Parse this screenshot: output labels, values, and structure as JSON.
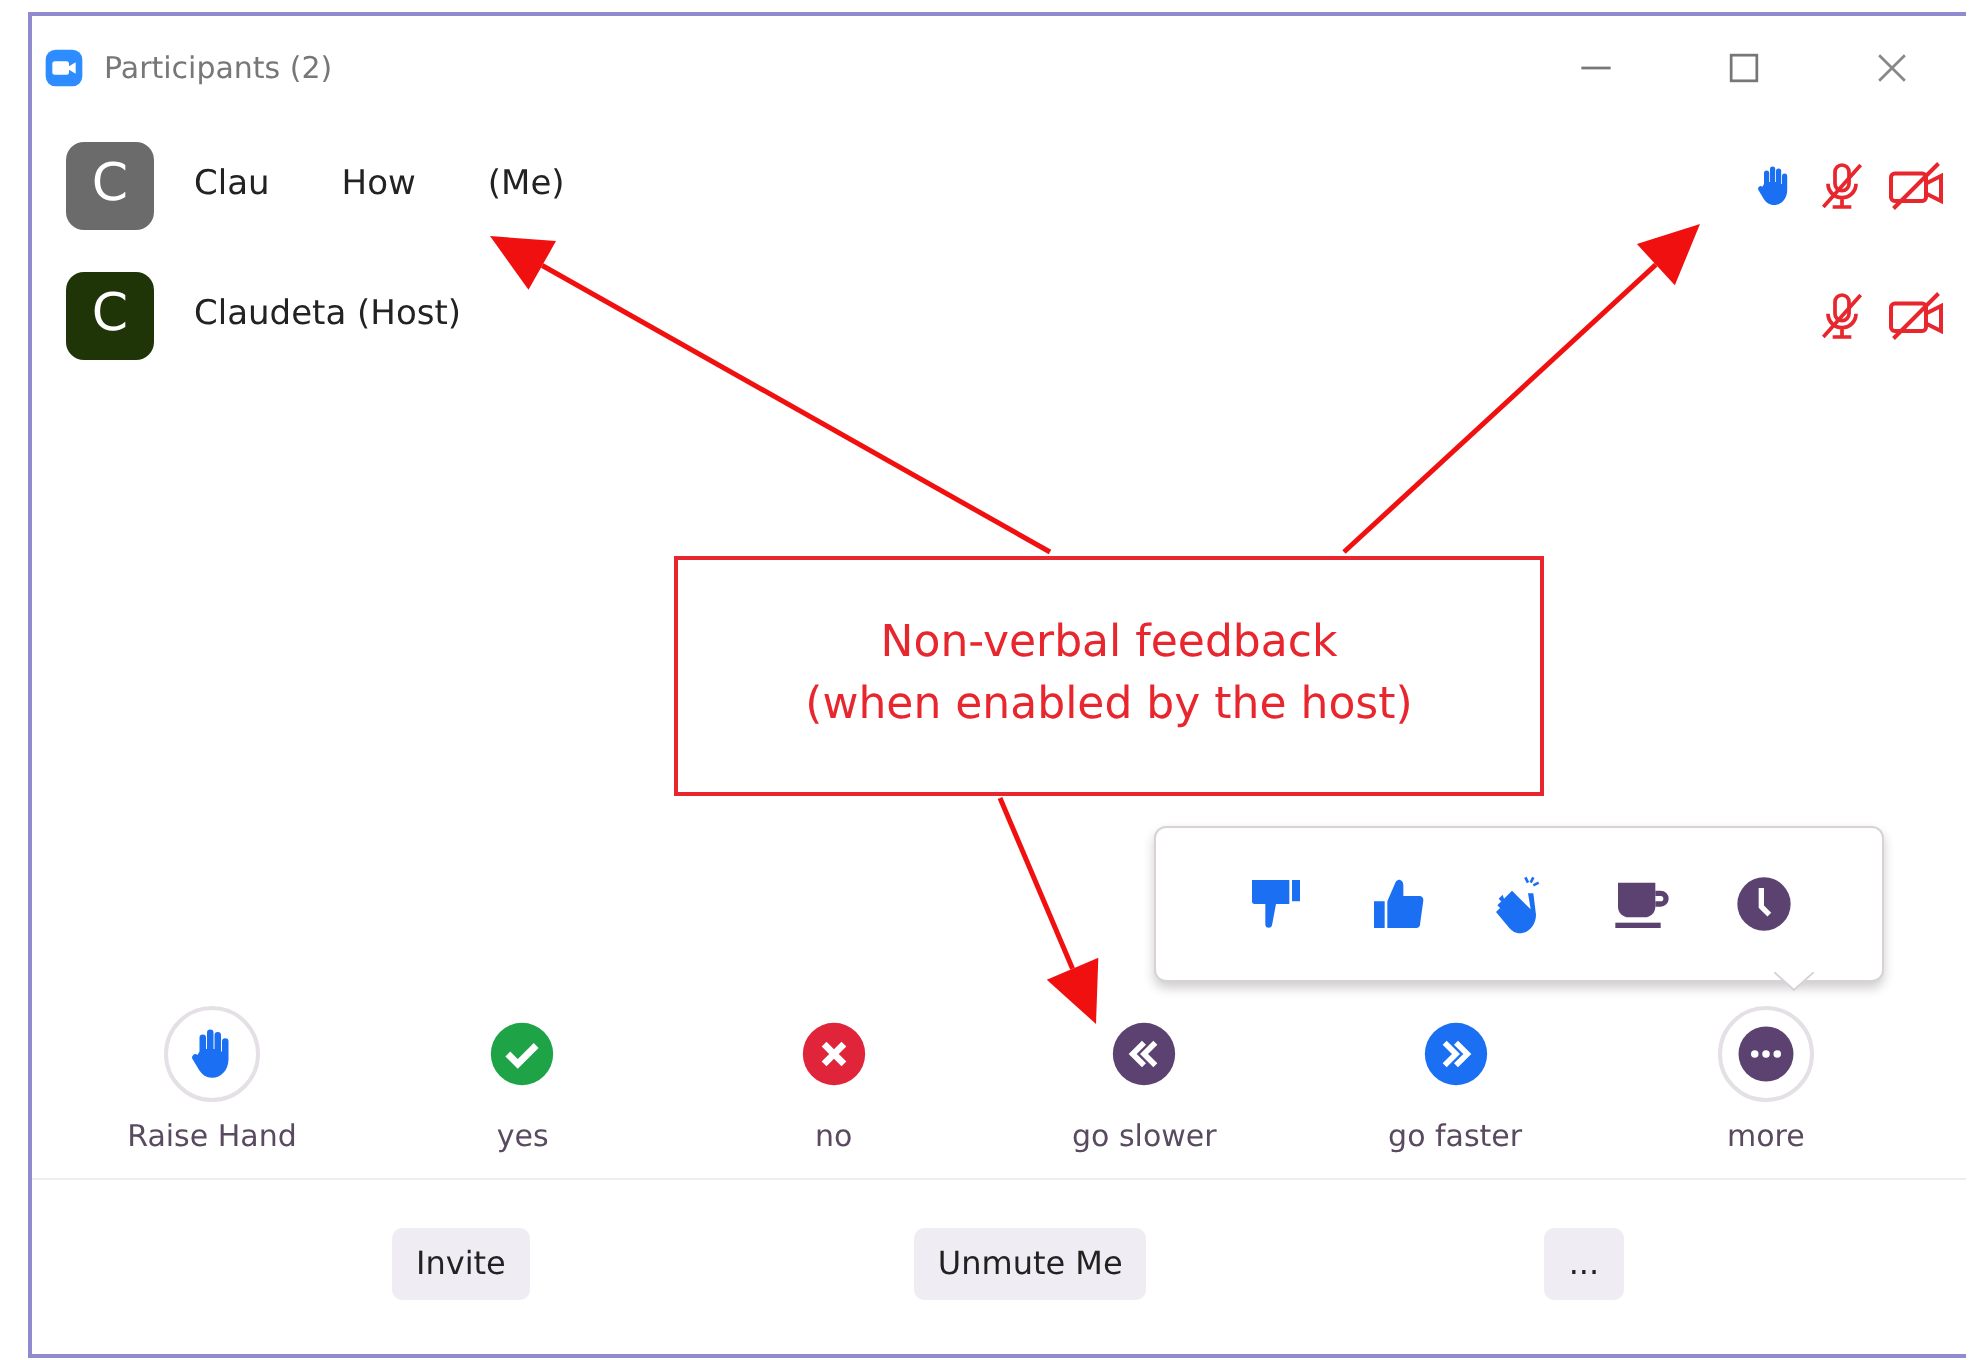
{
  "window": {
    "title": "Participants (2)"
  },
  "participants": [
    {
      "name_parts": [
        "Clau",
        "How",
        "(Me)"
      ],
      "avatar": "C",
      "color": "#6b6b6b",
      "hand_raised": true,
      "muted": true,
      "video_off": true
    },
    {
      "name_parts": [
        "Claudeta (Host)"
      ],
      "avatar": "C",
      "color": "#1f3508",
      "hand_raised": false,
      "muted": true,
      "video_off": true
    }
  ],
  "annotation": {
    "lines": [
      "Non-verbal feedback",
      "(when enabled by the host)"
    ]
  },
  "feedback_popup": {
    "items": [
      {
        "kind": "thumbs-down",
        "color": "#1a6ff2"
      },
      {
        "kind": "thumbs-up",
        "color": "#1a6ff2"
      },
      {
        "kind": "clap",
        "color": "#1a6ff2"
      },
      {
        "kind": "coffee",
        "color": "#5b4270"
      },
      {
        "kind": "clock",
        "color": "#5b4270"
      }
    ]
  },
  "reactions": [
    {
      "kind": "raise-hand",
      "label": "Raise Hand"
    },
    {
      "kind": "yes",
      "label": "yes"
    },
    {
      "kind": "no",
      "label": "no"
    },
    {
      "kind": "slower",
      "label": "go slower"
    },
    {
      "kind": "faster",
      "label": "go faster"
    },
    {
      "kind": "more",
      "label": "more"
    }
  ],
  "buttons": [
    "Invite",
    "Unmute Me",
    "..."
  ]
}
